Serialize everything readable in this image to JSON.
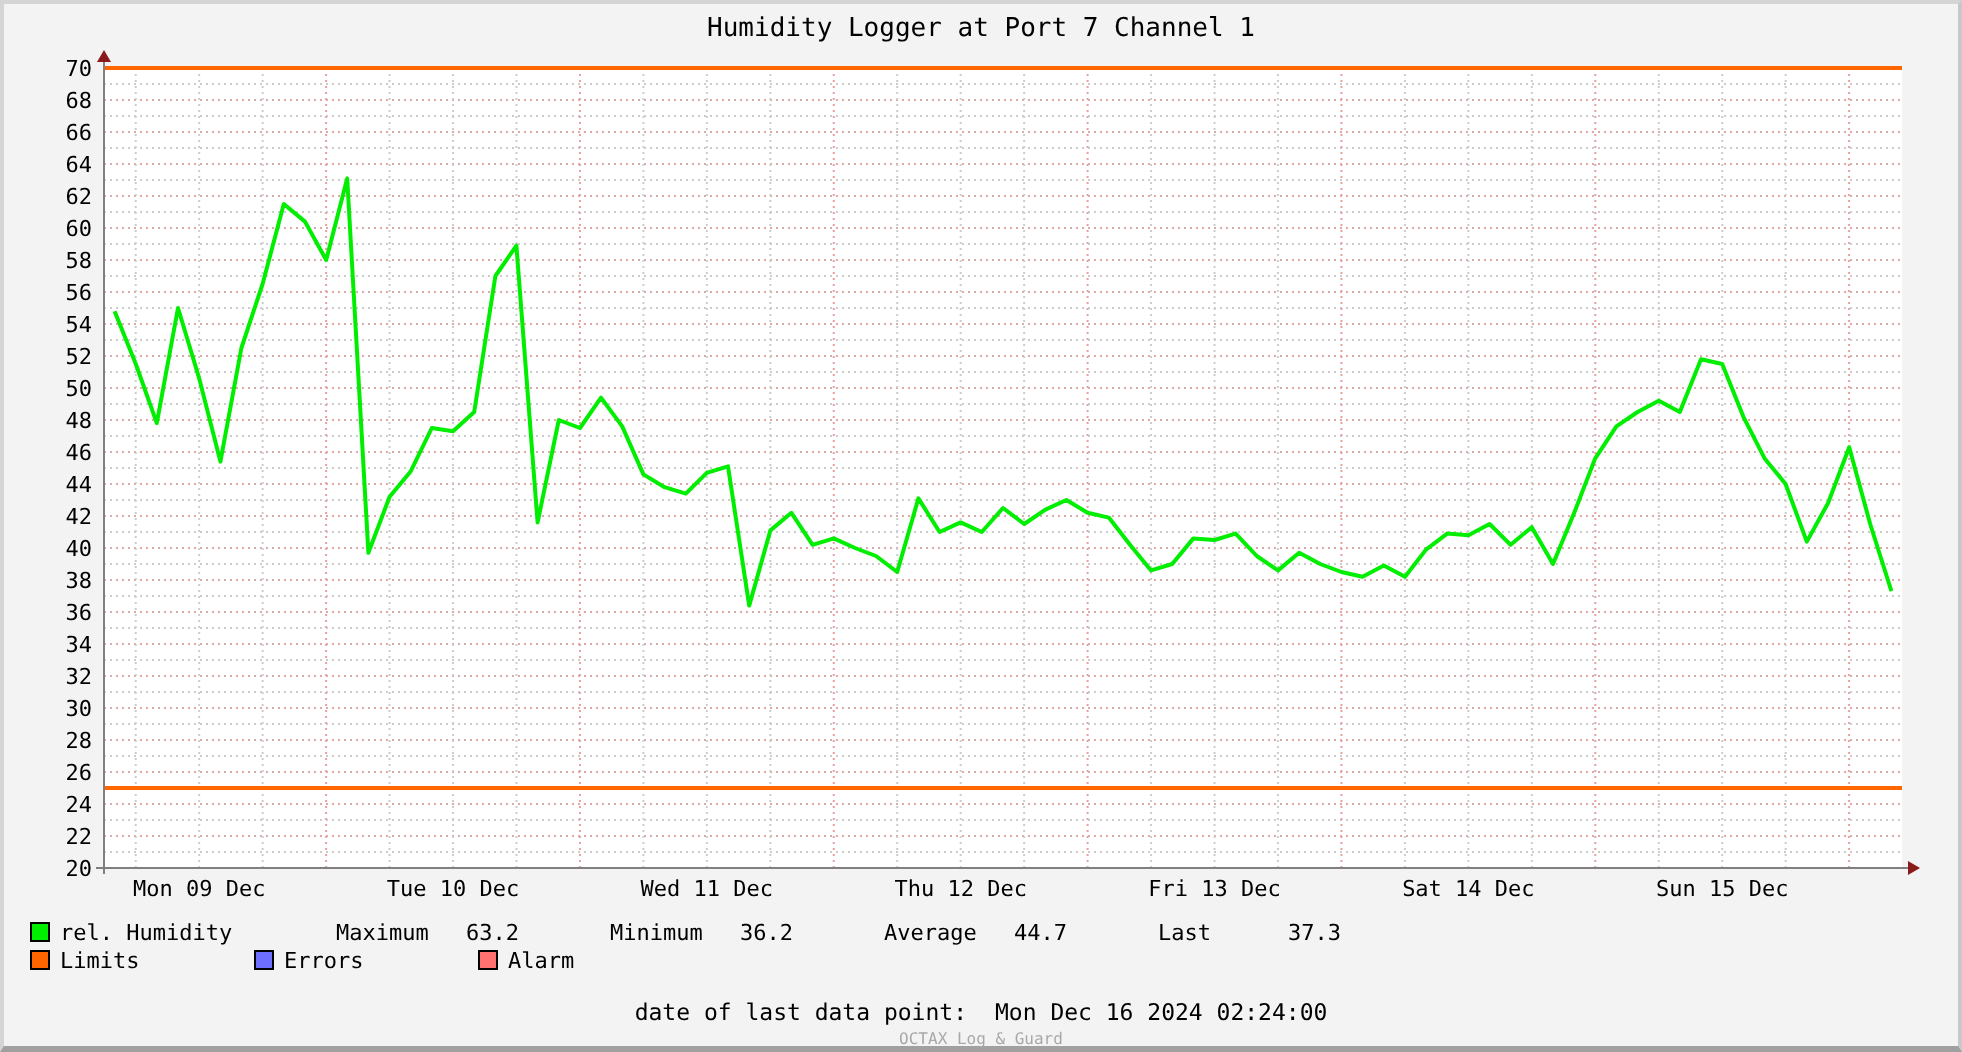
{
  "title": "Humidity Logger at Port 7 Channel 1",
  "chart_data": {
    "type": "line",
    "ylim": [
      20,
      70
    ],
    "yticks": [
      20,
      22,
      24,
      26,
      28,
      30,
      32,
      34,
      36,
      38,
      40,
      42,
      44,
      46,
      48,
      50,
      52,
      54,
      56,
      58,
      60,
      62,
      64,
      66,
      68,
      70
    ],
    "categories": [
      null,
      null,
      null,
      null,
      "Mon 09 Dec",
      null,
      null,
      null,
      null,
      null,
      null,
      null,
      null,
      null,
      null,
      null,
      "Tue 10 Dec",
      null,
      null,
      null,
      null,
      null,
      null,
      null,
      null,
      null,
      null,
      null,
      "Wed 11 Dec",
      null,
      null,
      null,
      null,
      null,
      null,
      null,
      null,
      null,
      null,
      null,
      "Thu 12 Dec",
      null,
      null,
      null,
      null,
      null,
      null,
      null,
      null,
      null,
      null,
      null,
      "Fri 13 Dec",
      null,
      null,
      null,
      null,
      null,
      null,
      null,
      null,
      null,
      null,
      null,
      "Sat 14 Dec",
      null,
      null,
      null,
      null,
      null,
      null,
      null,
      null,
      null,
      null,
      null,
      "Sun 15 Dec",
      null,
      null,
      null,
      null,
      null,
      null,
      null,
      null
    ],
    "series": [
      {
        "name": "rel. Humidity",
        "color": "#00ee00",
        "values": [
          54.8,
          51.5,
          47.8,
          55.0,
          50.6,
          45.4,
          52.5,
          56.5,
          61.5,
          60.4,
          58.0,
          63.1,
          39.7,
          43.2,
          44.8,
          47.5,
          47.3,
          48.5,
          57.0,
          58.9,
          41.6,
          48.0,
          47.5,
          49.4,
          47.6,
          44.6,
          43.8,
          43.4,
          44.7,
          45.1,
          36.4,
          41.1,
          42.2,
          40.2,
          40.6,
          40.0,
          39.5,
          38.5,
          43.1,
          41.0,
          41.6,
          41.0,
          42.5,
          41.5,
          42.4,
          43.0,
          42.2,
          41.9,
          40.2,
          38.6,
          39.0,
          40.6,
          40.5,
          40.9,
          39.5,
          38.6,
          39.7,
          39.0,
          38.5,
          38.2,
          38.9,
          38.2,
          39.9,
          40.9,
          40.8,
          41.5,
          40.2,
          41.3,
          39.0,
          42.2,
          45.6,
          47.6,
          48.5,
          49.2,
          48.5,
          51.8,
          51.5,
          48.2,
          45.6,
          44.0,
          40.4,
          42.8,
          46.3,
          41.5,
          37.3
        ]
      }
    ],
    "grid": true,
    "ref_lines": [
      {
        "axis": "y",
        "value": 70,
        "color": "#ff6600"
      },
      {
        "axis": "y",
        "value": 25,
        "color": "#ff6600"
      }
    ]
  },
  "stats": [
    {
      "label": "Maximum",
      "value": "63.2"
    },
    {
      "label": "Minimum",
      "value": "36.2"
    },
    {
      "label": "Average",
      "value": "44.7"
    },
    {
      "label": "Last",
      "value": "37.3"
    }
  ],
  "legend": [
    {
      "label": "Limits",
      "color": "#ff6600"
    },
    {
      "label": "Errors",
      "color": "#6f6fff"
    },
    {
      "label": "Alarm",
      "color": "#ff7070"
    }
  ],
  "footer": {
    "label": "date of last data point:",
    "value": "Mon Dec 16 2024 02:24:00"
  },
  "watermark": "OCTAX Log & Guard"
}
